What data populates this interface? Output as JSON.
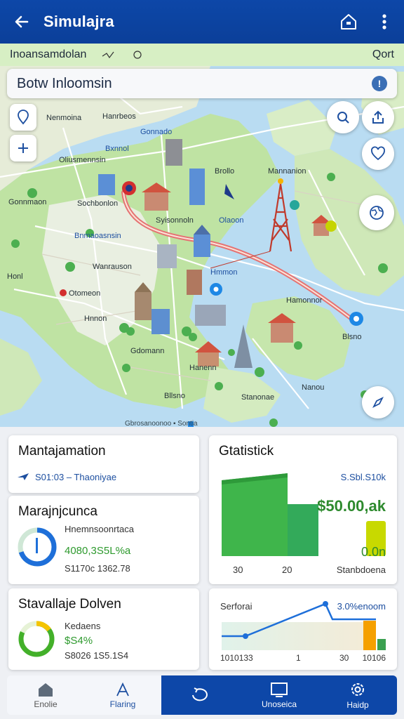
{
  "header": {
    "title": "Simulajra",
    "back_icon": "arrow-left-icon",
    "home_icon": "home-icon",
    "menu_icon": "more-vertical-icon"
  },
  "map": {
    "location_label": "Inoansamdolan",
    "port_label": "Qort",
    "search": {
      "value": "Botw Inloomsin",
      "placeholder": "Botw Inloomsin"
    },
    "info_badge": "!",
    "labels": [
      "Nenmoina",
      "Hanrbeos",
      "Gonnado",
      "Bxnnol",
      "Oliusmennsin",
      "Brollo",
      "Mannanion",
      "Sochbonlon",
      "Gonnmaon",
      "Syisonnoln",
      "Olaoon",
      "Bnmaoasnsin",
      "Wanrauson",
      "Hmmon",
      "Honl",
      "Otomeon",
      "Hamonnor",
      "Hnnon",
      "Blsno",
      "Gdomann",
      "Hanenn",
      "Nanou",
      "Bllsno",
      "Stanonae"
    ],
    "attribution": "Gbrosanoonoo ▪ Sontia",
    "accent": "#0d47a8",
    "route_color": "#e57373"
  },
  "cards": {
    "main": {
      "title": "Mantajamation",
      "value": "S01:03 – Thaoniyae"
    },
    "progress": {
      "title": "Marajnjcunca",
      "line1": "Hnemnsoonrtaca",
      "line2": "4080,3S5L%a",
      "line3": "S1170c 1362.78",
      "ring_fraction": 0.7
    },
    "stats": {
      "title": "Gtatistick",
      "top_value": "S.Sbl.S10k",
      "big_value": "$50.00,ak",
      "small_value": "0.0n",
      "bar_labels": [
        "30",
        "20",
        "Stanbdoena"
      ]
    },
    "bottom_left": {
      "title": "Stavallaje Dolven",
      "line1": "Kedaens",
      "line2": "$S4%",
      "line3": "S8026 1S5.1S4",
      "ring_fraction": 0.82
    },
    "trend": {
      "title": "Serforai",
      "peak_label": "3.0%enoom",
      "axis_labels": [
        "1010133",
        "1",
        "30",
        "10106"
      ]
    }
  },
  "nav": {
    "items": [
      {
        "label": "Enolie",
        "icon": "home-icon"
      },
      {
        "label": "Flaring",
        "icon": "flag-icon"
      },
      {
        "label": "",
        "icon": "refresh-icon"
      },
      {
        "label": "Unoseica",
        "icon": "monitor-icon"
      },
      {
        "label": "Haidp",
        "icon": "settings-icon"
      }
    ]
  }
}
